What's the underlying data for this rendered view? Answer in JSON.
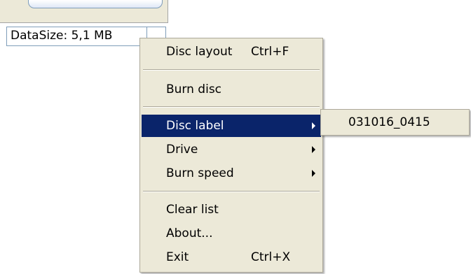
{
  "status_bar": {
    "data_size": "DataSize: 5,1 MB"
  },
  "context_menu": {
    "items": [
      {
        "label": "Disc layout",
        "shortcut": "Ctrl+F",
        "has_submenu": false
      },
      {
        "label": "Burn disc",
        "shortcut": "",
        "has_submenu": false
      },
      {
        "label": "Disc label",
        "shortcut": "",
        "has_submenu": true,
        "highlighted": true
      },
      {
        "label": "Drive",
        "shortcut": "",
        "has_submenu": true
      },
      {
        "label": "Burn speed",
        "shortcut": "",
        "has_submenu": true
      },
      {
        "label": "Clear list",
        "shortcut": "",
        "has_submenu": false
      },
      {
        "label": "About...",
        "shortcut": "",
        "has_submenu": false
      },
      {
        "label": "Exit",
        "shortcut": "Ctrl+X",
        "has_submenu": false
      }
    ]
  },
  "submenu": {
    "items": [
      {
        "label": "031016_0415"
      }
    ]
  },
  "colors": {
    "menu_background": "#ece9d8",
    "highlight_background": "#0a246a",
    "highlight_text": "#ffffff",
    "border": "#aca899",
    "status_border": "#7f9db9"
  }
}
